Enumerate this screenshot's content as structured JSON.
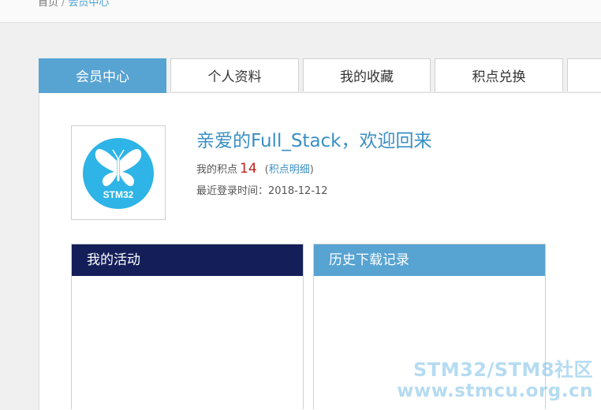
{
  "breadcrumb": {
    "home": "首页",
    "separator": "/",
    "current": "会员中心"
  },
  "tabs": [
    {
      "label": "会员中心",
      "active": true
    },
    {
      "label": "个人资料",
      "active": false
    },
    {
      "label": "我的收藏",
      "active": false
    },
    {
      "label": "积点兑换",
      "active": false
    },
    {
      "label": "",
      "active": false
    }
  ],
  "profile": {
    "avatar_icon": "stm32-butterfly-logo",
    "avatar_logo_text": "STM32",
    "welcome": "亲爱的Full_Stack，欢迎回来",
    "points_label": "我的积点",
    "points_value": "14",
    "points_detail_open": "(",
    "points_detail_link": "积点明细",
    "points_detail_close": ")",
    "last_login_label": "最近登录时间：",
    "last_login_value": "2018-12-12"
  },
  "sections": {
    "activity_title": "我的活动",
    "history_title": "历史下载记录"
  },
  "watermark": {
    "line1": "STM32/STM8社区",
    "line2": "www.stmcu.org.cn"
  },
  "colors": {
    "accent": "#57a3d2",
    "dark_header": "#141f5a",
    "points": "#c0201c",
    "link": "#3a8fc4",
    "logo": "#2eb4e6"
  }
}
